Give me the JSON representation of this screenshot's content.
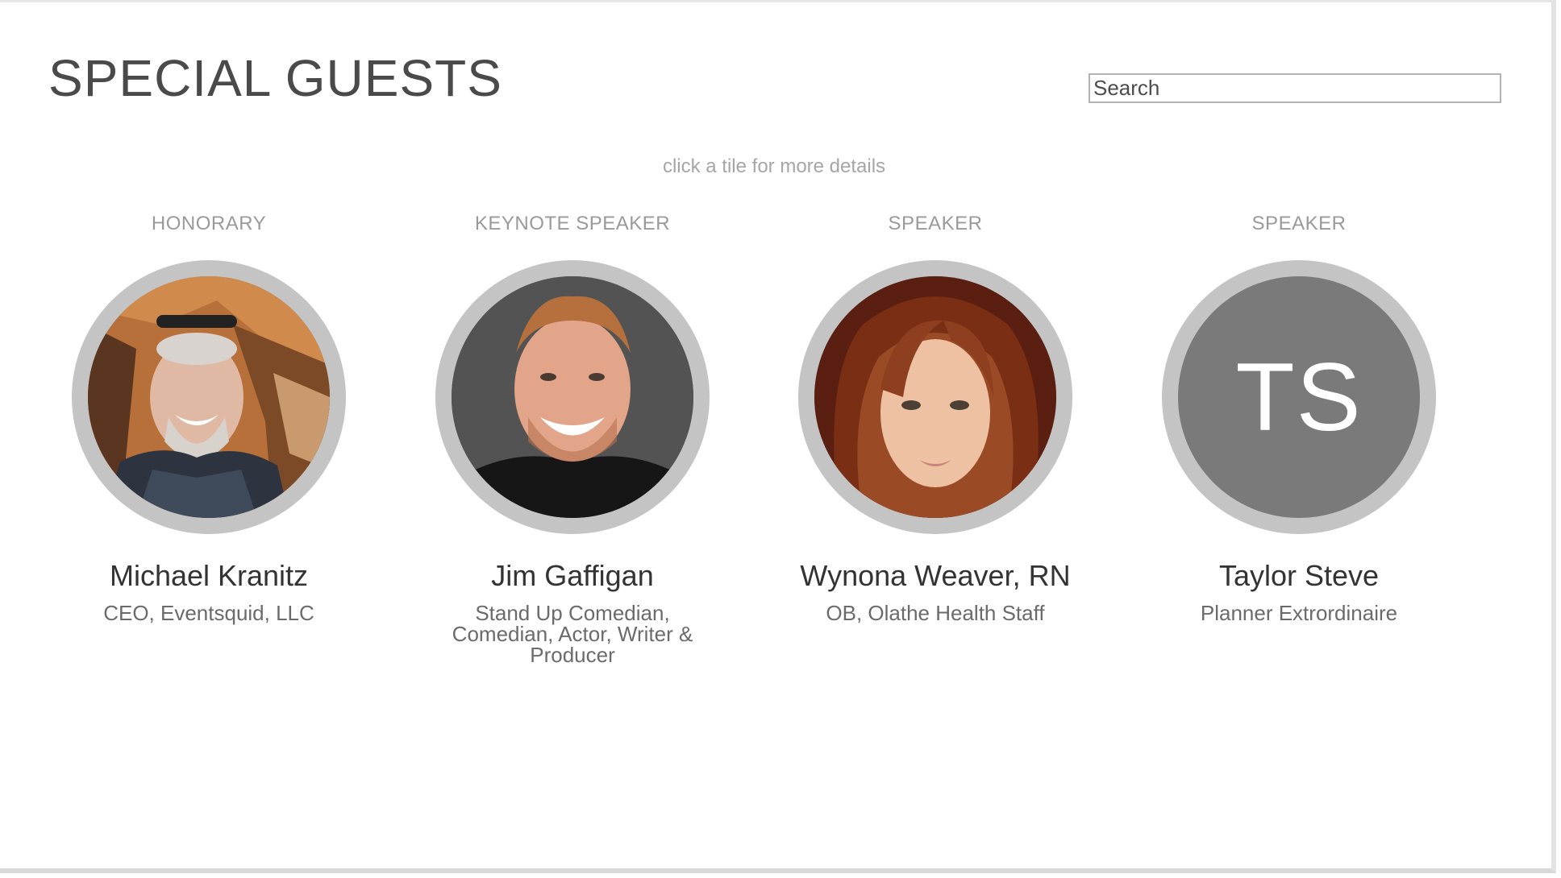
{
  "page": {
    "title": "SPECIAL GUESTS",
    "hint": "click a tile for more details"
  },
  "search": {
    "placeholder": "Search",
    "value": ""
  },
  "guests": [
    {
      "role": "HONORARY",
      "name": "Michael Kranitz",
      "description": "CEO, Eventsquid, LLC",
      "avatar": "photo-man-sunglasses-on-head-rocks"
    },
    {
      "role": "KEYNOTE SPEAKER",
      "name": "Jim Gaffigan",
      "description": "Stand Up Comedian, Comedian, Actor, Writer & Producer",
      "avatar": "photo-smiling-man-dark-background"
    },
    {
      "role": "SPEAKER",
      "name": "Wynona Weaver, RN",
      "description": "OB, Olathe Health Staff",
      "avatar": "photo-woman-red-brown-hair"
    },
    {
      "role": "SPEAKER",
      "name": "Taylor Steve",
      "description": "Planner Extrordinaire",
      "initials": "TS",
      "avatar": "initials-placeholder"
    }
  ],
  "colors": {
    "ring": "#c4c4c4",
    "initials_bg": "#7a7a7a",
    "title": "#4a4a4a",
    "muted": "#9a9a9a"
  }
}
